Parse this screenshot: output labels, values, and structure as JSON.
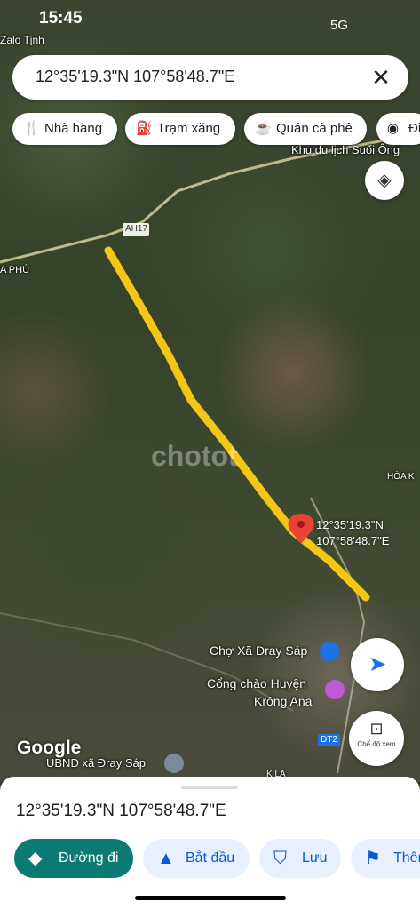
{
  "status_bar": {
    "time": "15:45",
    "network": "5G"
  },
  "search": {
    "value": "12°35'19.3\"N 107°58'48.7\"E"
  },
  "chips": [
    {
      "label": "Nhà hàng",
      "icon": "restaurant-icon"
    },
    {
      "label": "Trạm xăng",
      "icon": "gas-station-icon"
    },
    {
      "label": "Quán cà phê",
      "icon": "coffee-icon"
    },
    {
      "label": "Đi",
      "icon": "attraction-icon"
    }
  ],
  "map": {
    "labels": {
      "top_left": "Zalo Tịnh",
      "resort": "Khu du lịch Suối Ông",
      "road": "AH17",
      "town": "A PHÚ",
      "district": "HÒA K",
      "market": "Chợ Xã Dray Sáp",
      "gate1": "Cổng chào Huyện",
      "gate2": "Krông Ana",
      "dt2": "DT2",
      "ubnd": "UBND xã Đray Sáp",
      "kla": "K LA"
    },
    "pin_line1": "12°35'19.3\"N",
    "pin_line2": "107°58'48.7\"E",
    "watermark": "chotot",
    "google": "Google",
    "view_mode": "Chế độ xem"
  },
  "sheet": {
    "coords": "12°35'19.3\"N 107°58'48.7\"E",
    "actions": [
      {
        "label": "Đường đi",
        "icon": "directions-icon"
      },
      {
        "label": "Bắt đầu",
        "icon": "navigation-icon"
      },
      {
        "label": "Lưu",
        "icon": "bookmark-icon"
      },
      {
        "label": "Thêm",
        "icon": "flag-icon"
      }
    ]
  },
  "colors": {
    "accent": "#0b7a75",
    "highlight": "#f5c518",
    "pin": "#ea4335"
  }
}
